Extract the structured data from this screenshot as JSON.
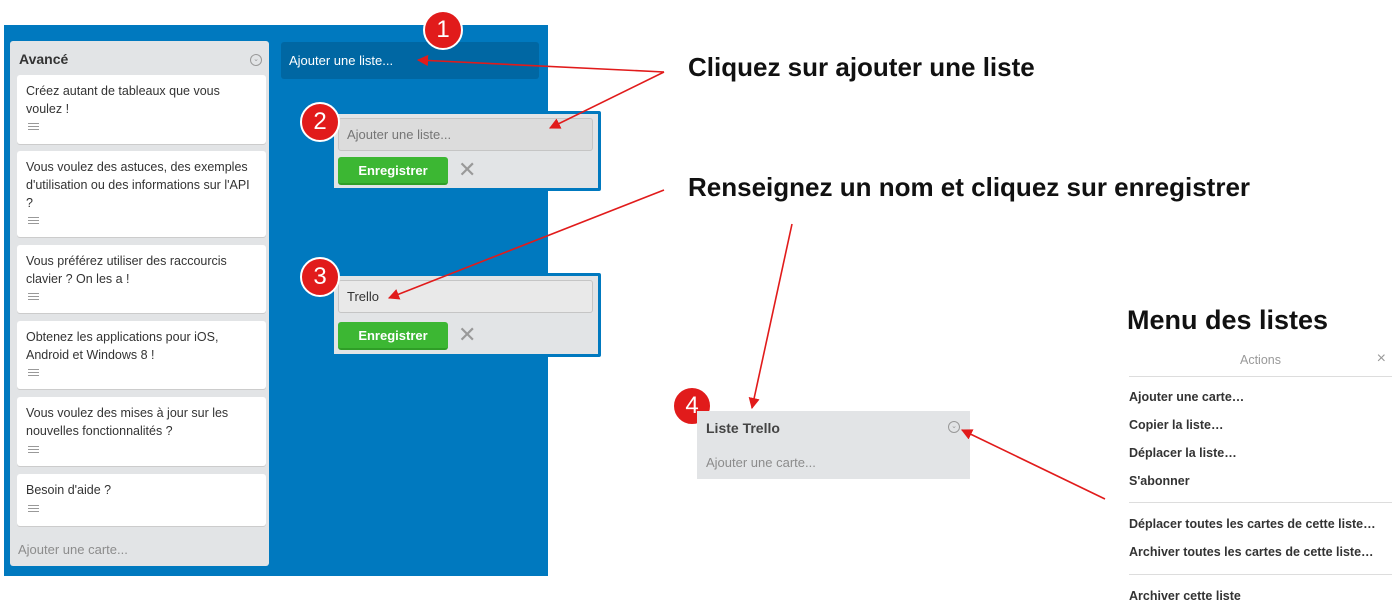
{
  "board": {
    "left_list": {
      "title": "Avancé",
      "cards": [
        {
          "text": "Créez autant de tableaux que vous voulez !"
        },
        {
          "text": "Vous voulez des astuces, des exemples d'utilisation ou des informations sur l'API ?"
        },
        {
          "text": "Vous préférez utiliser des raccourcis clavier ? On les a !"
        },
        {
          "text": "Obtenez les applications pour iOS, Android et Windows 8 !"
        },
        {
          "text": "Vous voulez des mises à jour sur les nouvelles fonctionnalités ?"
        },
        {
          "text": "Besoin d'aide ?"
        }
      ],
      "add_card": "Ajouter une carte..."
    },
    "add_list_link": "Ajouter une liste..."
  },
  "form_empty": {
    "placeholder": "Ajouter une liste...",
    "save_label": "Enregistrer",
    "close": "✕"
  },
  "form_filled": {
    "value": "Trello",
    "save_label": "Enregistrer",
    "close": "✕"
  },
  "steps": [
    "1",
    "2",
    "3",
    "4"
  ],
  "instructions": {
    "step1": "Cliquez sur ajouter une liste",
    "step2": "Renseignez un nom et cliquez sur enregistrer",
    "menu_title": "Menu des listes"
  },
  "result_list": {
    "title": "Liste Trello",
    "add_card": "Ajouter une carte..."
  },
  "actions_menu": {
    "header": "Actions",
    "close": "×",
    "items": [
      "Ajouter une carte…",
      "Copier la liste…",
      "Déplacer la liste…",
      "S'abonner",
      "Déplacer toutes les cartes de cette liste…",
      "Archiver toutes les cartes de cette liste…",
      "Archiver cette liste"
    ]
  },
  "colors": {
    "board": "#0079bf",
    "badge": "#e11b1b",
    "save_button": "#3cb733",
    "arrow": "#e11b1b"
  }
}
